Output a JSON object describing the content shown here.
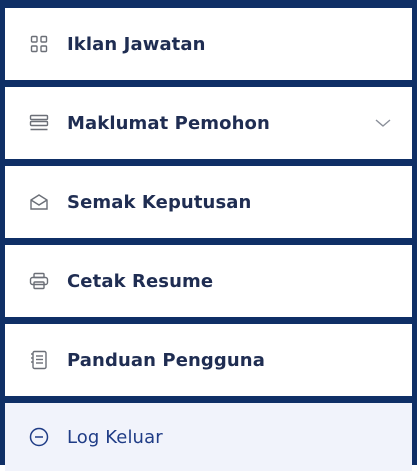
{
  "menu": {
    "items": [
      {
        "label": "Iklan Jawatan",
        "icon": "grid-icon"
      },
      {
        "label": "Maklumat Pemohon",
        "icon": "list-icon",
        "has_dropdown": true
      },
      {
        "label": "Semak Keputusan",
        "icon": "envelope-icon"
      },
      {
        "label": "Cetak Resume",
        "icon": "printer-icon"
      },
      {
        "label": "Panduan Pengguna",
        "icon": "document-icon"
      },
      {
        "label": "Log Keluar",
        "icon": "minus-circle-icon"
      }
    ]
  },
  "colors": {
    "border": "#0f2f66",
    "text": "#1f2d52",
    "icon": "#6b6f77",
    "logout_bg": "#f1f3fb",
    "logout_text": "#1f3c86"
  }
}
